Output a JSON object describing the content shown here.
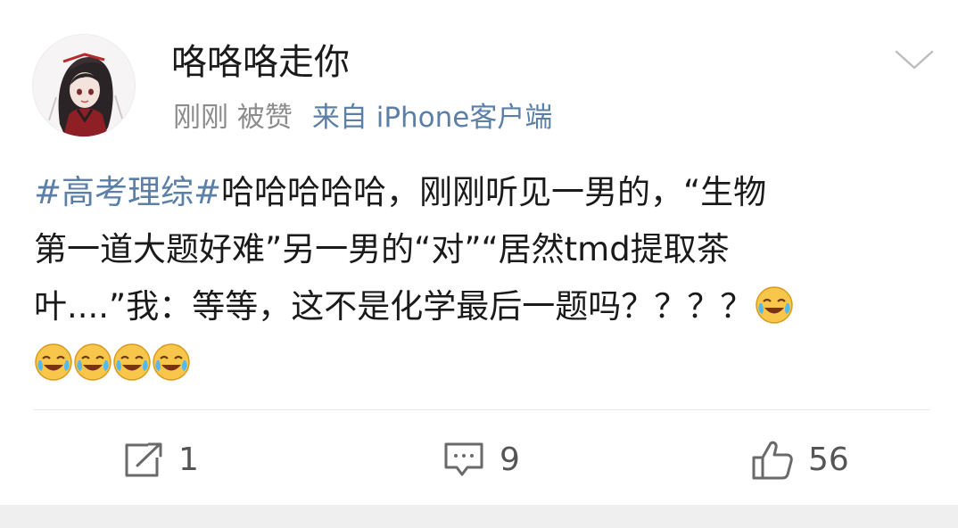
{
  "post": {
    "username": "咯咯咯走你",
    "time": "刚刚",
    "liked_tag": "被赞",
    "source": "来自 iPhone客户端",
    "hashtag": "#高考理综#",
    "line1_text": "哈哈哈哈哈，刚刚听见一男的，“生物",
    "line2_text": "第一道大题好难”另一男的“对”“居然tmd提取茶",
    "line3_text": "叶....”我：等等，这不是化学最后一题吗？？？？",
    "emoji_name": "laughing-crying-emoji"
  },
  "actions": {
    "repost_count": "1",
    "comment_count": "9",
    "like_count": "56"
  },
  "colors": {
    "link": "#5b7fa7",
    "meta": "#8c8c8c",
    "text": "#1a1a1a",
    "footer_band": "#efefef"
  }
}
